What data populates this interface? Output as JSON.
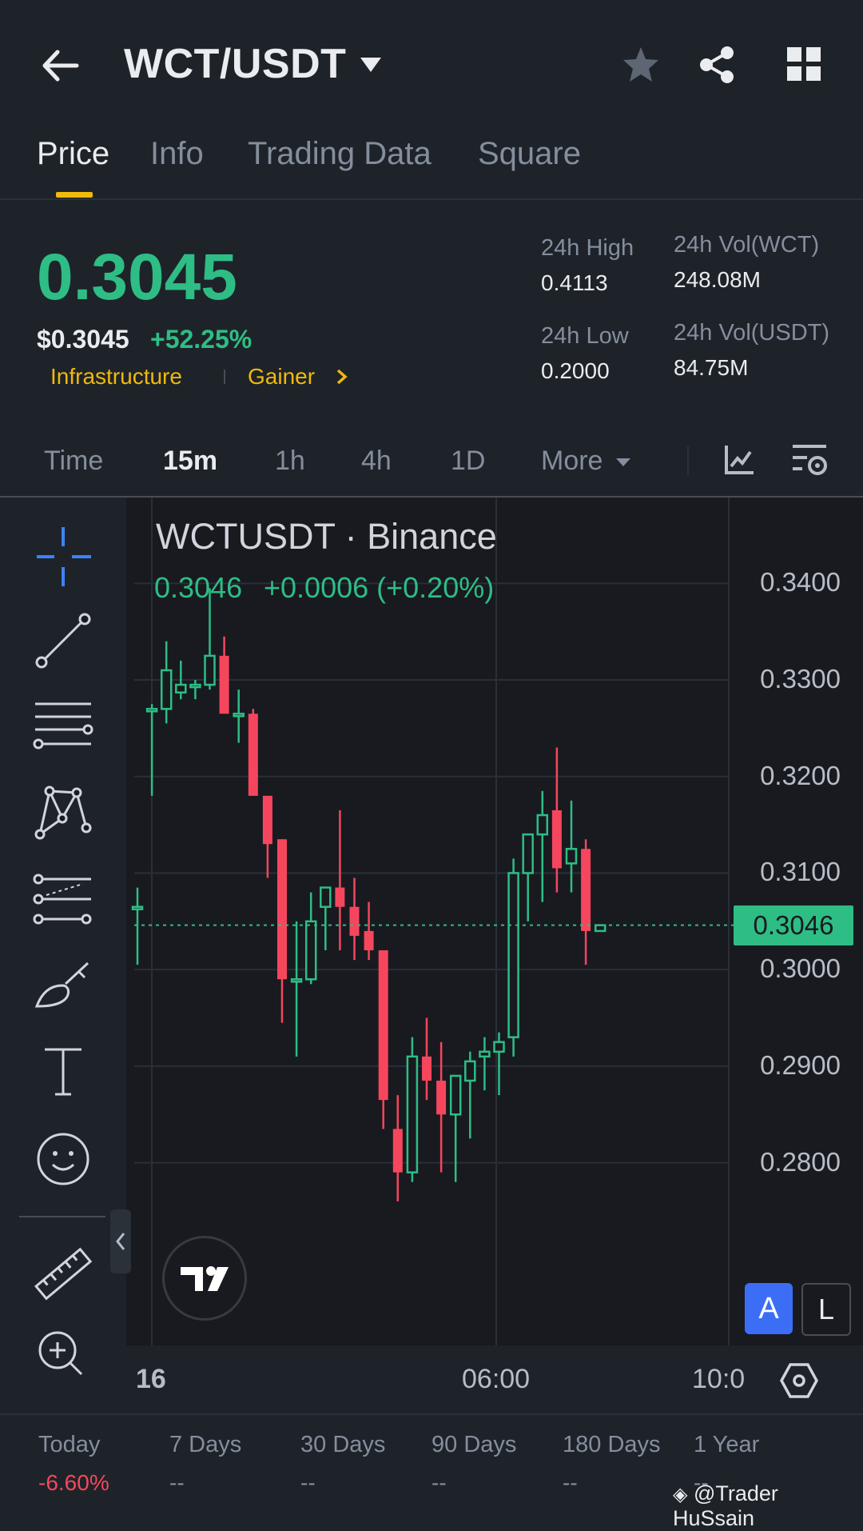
{
  "header": {
    "back_icon": "arrow-left-icon",
    "pair": "WCT/USDT",
    "star_icon": "star-icon",
    "share_icon": "share-icon",
    "grid_icon": "grid-icon"
  },
  "tabs": [
    {
      "label": "Price",
      "active": true
    },
    {
      "label": "Info",
      "active": false
    },
    {
      "label": "Trading Data",
      "active": false
    },
    {
      "label": "Square",
      "active": false
    }
  ],
  "ticker": {
    "last_price": "0.3045",
    "usd_price": "$0.3045",
    "change_pct": "+52.25%",
    "tag_sector": "Infrastructure",
    "tag_rank": "Gainer",
    "high_label": "24h High",
    "high_value": "0.4113",
    "low_label": "24h Low",
    "low_value": "0.2000",
    "vol_base_label": "24h Vol(WCT)",
    "vol_base_value": "248.08M",
    "vol_quote_label": "24h Vol(USDT)",
    "vol_quote_value": "84.75M"
  },
  "intervals": [
    {
      "label": "Time",
      "active": false
    },
    {
      "label": "15m",
      "active": true
    },
    {
      "label": "1h",
      "active": false
    },
    {
      "label": "4h",
      "active": false
    },
    {
      "label": "1D",
      "active": false
    },
    {
      "label": "More",
      "active": false
    }
  ],
  "chart_header": {
    "symbol": "WCTUSDT · Binance",
    "price": "0.3046",
    "change": "+0.0006 (+0.20%)",
    "current_price_tag": "0.3046"
  },
  "chart_data": {
    "type": "candlestick",
    "ylim": [
      0.2745,
      0.3445
    ],
    "y_ticks": [
      "0.3400",
      "0.3300",
      "0.3200",
      "0.3100",
      "0.3000",
      "0.2900",
      "0.2800"
    ],
    "x_ticks": [
      "16",
      "06:00",
      "10:0"
    ],
    "colors": {
      "up": "#2ebd85",
      "down": "#f6465d"
    },
    "candles": [
      {
        "o": 0.3065,
        "h": 0.3085,
        "l": 0.3005,
        "c": 0.3065
      },
      {
        "o": 0.327,
        "h": 0.3275,
        "l": 0.318,
        "c": 0.327
      },
      {
        "o": 0.327,
        "h": 0.334,
        "l": 0.3255,
        "c": 0.331
      },
      {
        "o": 0.3287,
        "h": 0.332,
        "l": 0.328,
        "c": 0.3295
      },
      {
        "o": 0.3295,
        "h": 0.33,
        "l": 0.328,
        "c": 0.3295
      },
      {
        "o": 0.3295,
        "h": 0.3395,
        "l": 0.329,
        "c": 0.3325
      },
      {
        "o": 0.3325,
        "h": 0.3345,
        "l": 0.327,
        "c": 0.3265
      },
      {
        "o": 0.3265,
        "h": 0.329,
        "l": 0.3235,
        "c": 0.3265
      },
      {
        "o": 0.3265,
        "h": 0.327,
        "l": 0.318,
        "c": 0.318
      },
      {
        "o": 0.318,
        "h": 0.318,
        "l": 0.3095,
        "c": 0.313
      },
      {
        "o": 0.3135,
        "h": 0.3135,
        "l": 0.2945,
        "c": 0.299
      },
      {
        "o": 0.299,
        "h": 0.305,
        "l": 0.291,
        "c": 0.299
      },
      {
        "o": 0.299,
        "h": 0.308,
        "l": 0.2985,
        "c": 0.305
      },
      {
        "o": 0.3065,
        "h": 0.3085,
        "l": 0.302,
        "c": 0.3085
      },
      {
        "o": 0.3085,
        "h": 0.3165,
        "l": 0.302,
        "c": 0.3065
      },
      {
        "o": 0.3065,
        "h": 0.3095,
        "l": 0.301,
        "c": 0.3035
      },
      {
        "o": 0.304,
        "h": 0.307,
        "l": 0.301,
        "c": 0.302
      },
      {
        "o": 0.302,
        "h": 0.302,
        "l": 0.2835,
        "c": 0.2865
      },
      {
        "o": 0.2835,
        "h": 0.287,
        "l": 0.276,
        "c": 0.279
      },
      {
        "o": 0.279,
        "h": 0.293,
        "l": 0.278,
        "c": 0.291
      },
      {
        "o": 0.291,
        "h": 0.295,
        "l": 0.2865,
        "c": 0.2885
      },
      {
        "o": 0.2885,
        "h": 0.2925,
        "l": 0.279,
        "c": 0.285
      },
      {
        "o": 0.285,
        "h": 0.289,
        "l": 0.278,
        "c": 0.289
      },
      {
        "o": 0.2885,
        "h": 0.2915,
        "l": 0.2825,
        "c": 0.2905
      },
      {
        "o": 0.291,
        "h": 0.293,
        "l": 0.2875,
        "c": 0.2915
      },
      {
        "o": 0.2915,
        "h": 0.2935,
        "l": 0.287,
        "c": 0.2925
      },
      {
        "o": 0.293,
        "h": 0.3115,
        "l": 0.291,
        "c": 0.31
      },
      {
        "o": 0.31,
        "h": 0.314,
        "l": 0.305,
        "c": 0.314
      },
      {
        "o": 0.314,
        "h": 0.3185,
        "l": 0.307,
        "c": 0.316
      },
      {
        "o": 0.3165,
        "h": 0.323,
        "l": 0.308,
        "c": 0.3105
      },
      {
        "o": 0.311,
        "h": 0.3175,
        "l": 0.308,
        "c": 0.3125
      },
      {
        "o": 0.3125,
        "h": 0.3135,
        "l": 0.3005,
        "c": 0.304
      },
      {
        "o": 0.304,
        "h": 0.3046,
        "l": 0.304,
        "c": 0.3046
      }
    ]
  },
  "chart_controls": {
    "auto_label": "A",
    "log_label": "L"
  },
  "performance": [
    {
      "label": "Today",
      "value": "-6.60%"
    },
    {
      "label": "7 Days",
      "value": "--"
    },
    {
      "label": "30 Days",
      "value": "--"
    },
    {
      "label": "90 Days",
      "value": "--"
    },
    {
      "label": "180 Days",
      "value": "--"
    },
    {
      "label": "1 Year",
      "value": "--"
    }
  ],
  "watermark": "@Trader HuSsain"
}
